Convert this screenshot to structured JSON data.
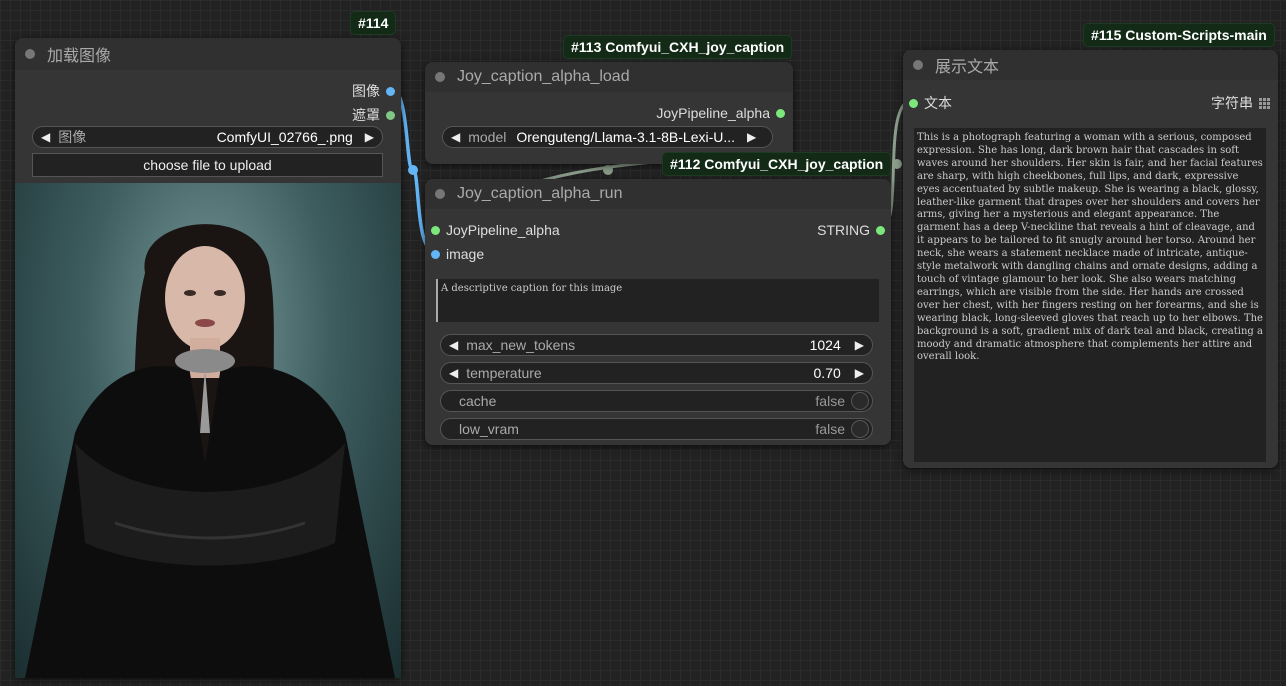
{
  "nodes": {
    "load_image": {
      "badge": "#114",
      "title": "加载图像",
      "outputs": [
        "图像",
        "遮罩"
      ],
      "image_widget": {
        "label": "图像",
        "value": "ComfyUI_02766_.png"
      },
      "upload_label": "choose file to upload"
    },
    "joy_load": {
      "badge": "#113 Comfyui_CXH_joy_caption",
      "title": "Joy_caption_alpha_load",
      "output": "JoyPipeline_alpha",
      "model_widget": {
        "label": "model",
        "value": "Orenguteng/Llama-3.1-8B-Lexi-U..."
      }
    },
    "joy_run": {
      "badge": "#112 Comfyui_CXH_joy_caption",
      "title": "Joy_caption_alpha_run",
      "inputs": [
        "JoyPipeline_alpha",
        "image"
      ],
      "output": "STRING",
      "prompt": "A descriptive caption for this image",
      "max_new_tokens": {
        "label": "max_new_tokens",
        "value": "1024"
      },
      "temperature": {
        "label": "temperature",
        "value": "0.70"
      },
      "cache": {
        "label": "cache",
        "value": "false"
      },
      "low_vram": {
        "label": "low_vram",
        "value": "false"
      }
    },
    "show_text": {
      "badge": "#115 Custom-Scripts-main",
      "title": "展示文本",
      "input": "文本",
      "output": "字符串",
      "text": "This is a photograph featuring a woman with a serious, composed expression. She has long, dark brown hair that cascades in soft waves around her shoulders. Her skin is fair, and her facial features are sharp, with high cheekbones, full lips, and dark, expressive eyes accentuated by subtle makeup. She is wearing a black, glossy, leather-like garment that drapes over her shoulders and covers her arms, giving her a mysterious and elegant appearance. The garment has a deep V-neckline that reveals a hint of cleavage, and it appears to be tailored to fit snugly around her torso. Around her neck, she wears a statement necklace made of intricate, antique-style metalwork with dangling chains and ornate designs, adding a touch of vintage glamour to her look. She also wears matching earrings, which are visible from the side. Her hands are crossed over her chest, with her fingers resting on her forearms, and she is wearing black, long-sleeved gloves that reach up to her elbows. The background is a soft, gradient mix of dark teal and black, creating a moody and dramatic atmosphere that complements her attire and overall look."
    }
  },
  "colors": {
    "image_link": "#64b5f6",
    "mask_link": "#81c784",
    "pipeline_link": "#a0b0a0",
    "string_link": "#a0b0a0",
    "slot_green": "#7ce87c",
    "slot_blue": "#64b5f6"
  }
}
